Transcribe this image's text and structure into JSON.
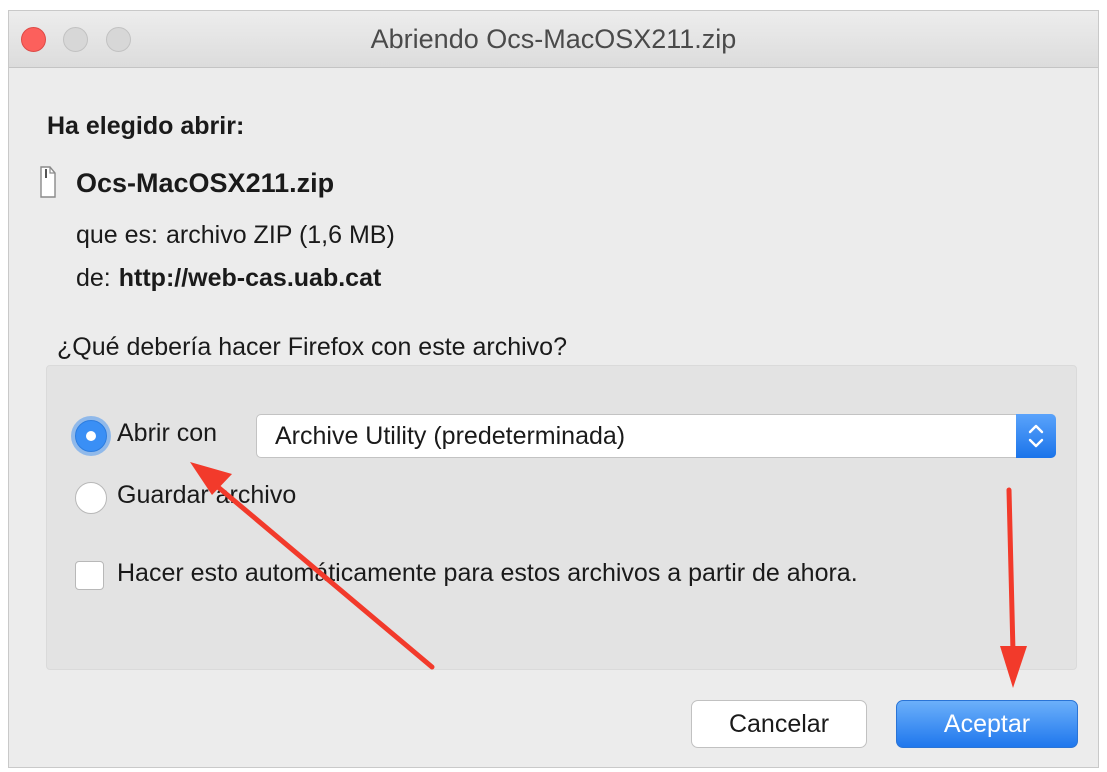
{
  "window": {
    "title": "Abriendo Ocs-MacOSX211.zip"
  },
  "dialog": {
    "heading": "Ha elegido abrir:",
    "file_name": "Ocs-MacOSX211.zip",
    "type_label": "que es:",
    "type_value": "archivo ZIP (1,6 MB)",
    "from_label": "de:",
    "from_value": "http://web-cas.uab.cat",
    "question": "¿Qué debería hacer Firefox con este archivo?",
    "options": {
      "open_with_label": "Abrir con",
      "open_with_selected": true,
      "app_select_value": "Archive Utility (predeterminada)",
      "save_label": "Guardar archivo",
      "save_selected": false,
      "auto_checkbox_label": "Hacer esto automáticamente para estos archivos a partir de ahora.",
      "auto_checked": false
    },
    "buttons": {
      "cancel": "Cancelar",
      "accept": "Aceptar"
    }
  },
  "colors": {
    "accent": "#3a8ff5",
    "annotation_arrow": "#f23a2b",
    "close_light": "#fc605c"
  },
  "icons": {
    "file": "document-icon",
    "select": "up-down-chevron-icon"
  }
}
